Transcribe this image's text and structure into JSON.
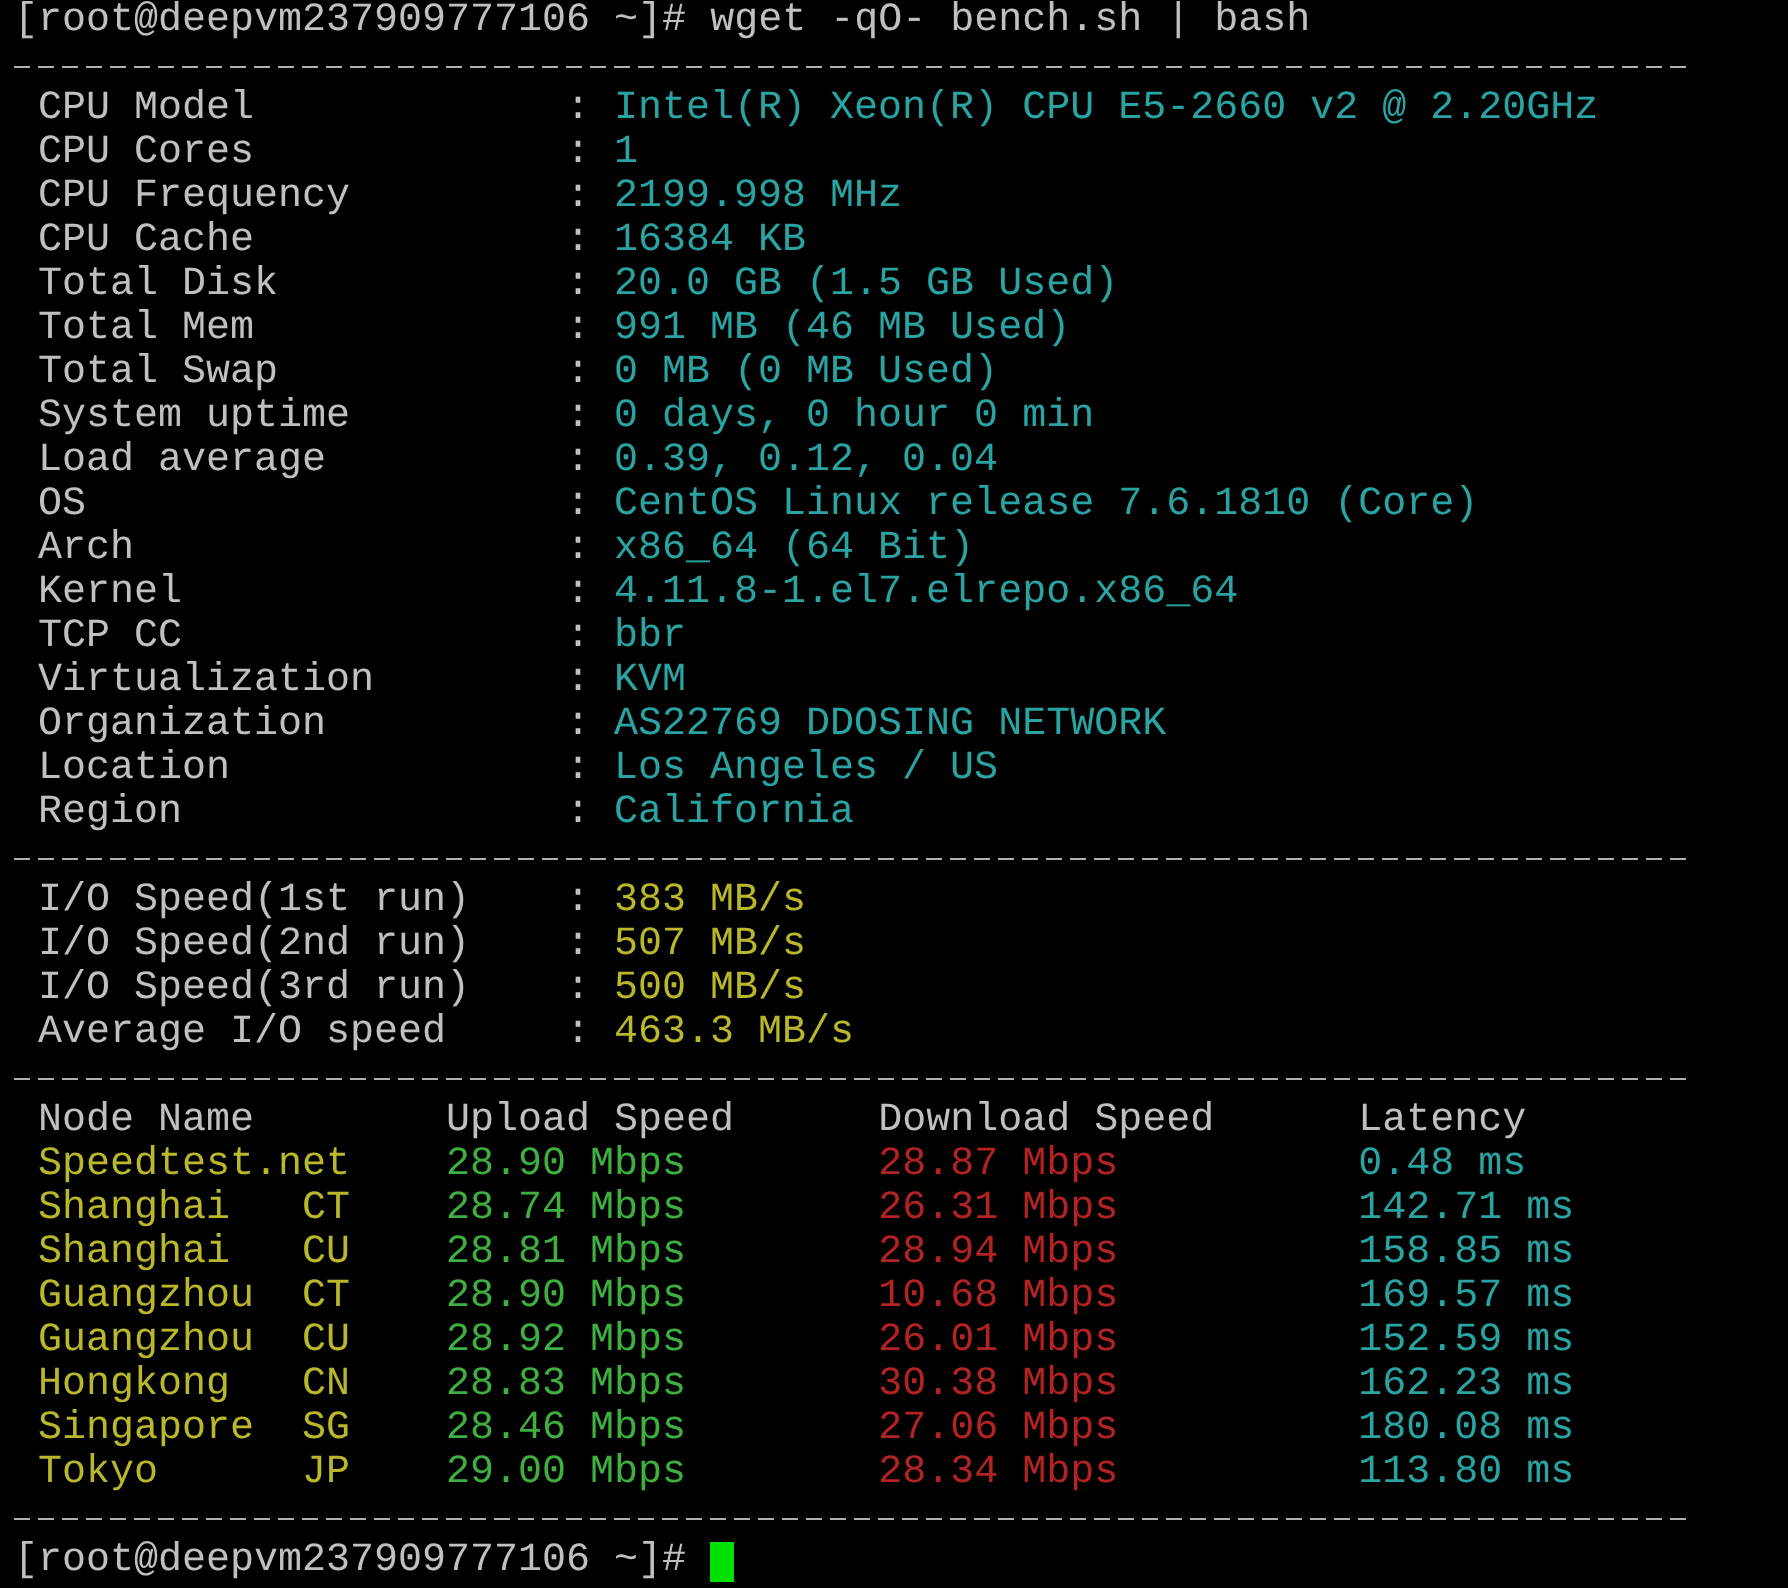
{
  "command_line": {
    "prompt": "[root@deepvm237909777106 ~]#",
    "command": "wget -qO- bench.sh | bash"
  },
  "system_info": [
    {
      "label": "CPU Model",
      "separator": ":",
      "value": "Intel(R) Xeon(R) CPU E5-2660 v2 @ 2.20GHz"
    },
    {
      "label": "CPU Cores",
      "separator": ":",
      "value": "1"
    },
    {
      "label": "CPU Frequency",
      "separator": ":",
      "value": "2199.998 MHz"
    },
    {
      "label": "CPU Cache",
      "separator": ":",
      "value": "16384 KB"
    },
    {
      "label": "Total Disk",
      "separator": ":",
      "value": "20.0 GB (1.5 GB Used)"
    },
    {
      "label": "Total Mem",
      "separator": ":",
      "value": "991 MB (46 MB Used)"
    },
    {
      "label": "Total Swap",
      "separator": ":",
      "value": "0 MB (0 MB Used)"
    },
    {
      "label": "System uptime",
      "separator": ":",
      "value": "0 days, 0 hour 0 min"
    },
    {
      "label": "Load average",
      "separator": ":",
      "value": "0.39, 0.12, 0.04"
    },
    {
      "label": "OS",
      "separator": ":",
      "value": "CentOS Linux release 7.6.1810 (Core)"
    },
    {
      "label": "Arch",
      "separator": ":",
      "value": "x86_64 (64 Bit)"
    },
    {
      "label": "Kernel",
      "separator": ":",
      "value": "4.11.8-1.el7.elrepo.x86_64"
    },
    {
      "label": "TCP CC",
      "separator": ":",
      "value": "bbr"
    },
    {
      "label": "Virtualization",
      "separator": ":",
      "value": "KVM"
    },
    {
      "label": "Organization",
      "separator": ":",
      "value": "AS22769 DDOSING NETWORK"
    },
    {
      "label": "Location",
      "separator": ":",
      "value": "Los Angeles / US"
    },
    {
      "label": "Region",
      "separator": ":",
      "value": "California"
    }
  ],
  "io_speed": [
    {
      "label": "I/O Speed(1st run)",
      "separator": ":",
      "value": "383 MB/s"
    },
    {
      "label": "I/O Speed(2nd run)",
      "separator": ":",
      "value": "507 MB/s"
    },
    {
      "label": "I/O Speed(3rd run)",
      "separator": ":",
      "value": "500 MB/s"
    },
    {
      "label": "Average I/O speed",
      "separator": ":",
      "value": "463.3 MB/s"
    }
  ],
  "speed_table": {
    "columns": [
      "Node Name",
      "Upload Speed",
      "Download Speed",
      "Latency"
    ],
    "rows": [
      {
        "node": "Speedtest.net",
        "upload": "28.90 Mbps",
        "download": "28.87 Mbps",
        "latency": "0.48 ms"
      },
      {
        "node": "Shanghai   CT",
        "upload": "28.74 Mbps",
        "download": "26.31 Mbps",
        "latency": "142.71 ms"
      },
      {
        "node": "Shanghai   CU",
        "upload": "28.81 Mbps",
        "download": "28.94 Mbps",
        "latency": "158.85 ms"
      },
      {
        "node": "Guangzhou  CT",
        "upload": "28.90 Mbps",
        "download": "10.68 Mbps",
        "latency": "169.57 ms"
      },
      {
        "node": "Guangzhou  CU",
        "upload": "28.92 Mbps",
        "download": "26.01 Mbps",
        "latency": "152.59 ms"
      },
      {
        "node": "Hongkong   CN",
        "upload": "28.83 Mbps",
        "download": "30.38 Mbps",
        "latency": "162.23 ms"
      },
      {
        "node": "Singapore  SG",
        "upload": "28.46 Mbps",
        "download": "27.06 Mbps",
        "latency": "180.08 ms"
      },
      {
        "node": "Tokyo      JP",
        "upload": "29.00 Mbps",
        "download": "28.34 Mbps",
        "latency": "113.80 ms"
      }
    ]
  },
  "final_prompt": {
    "prompt": "[root@deepvm237909777106 ~]#"
  }
}
